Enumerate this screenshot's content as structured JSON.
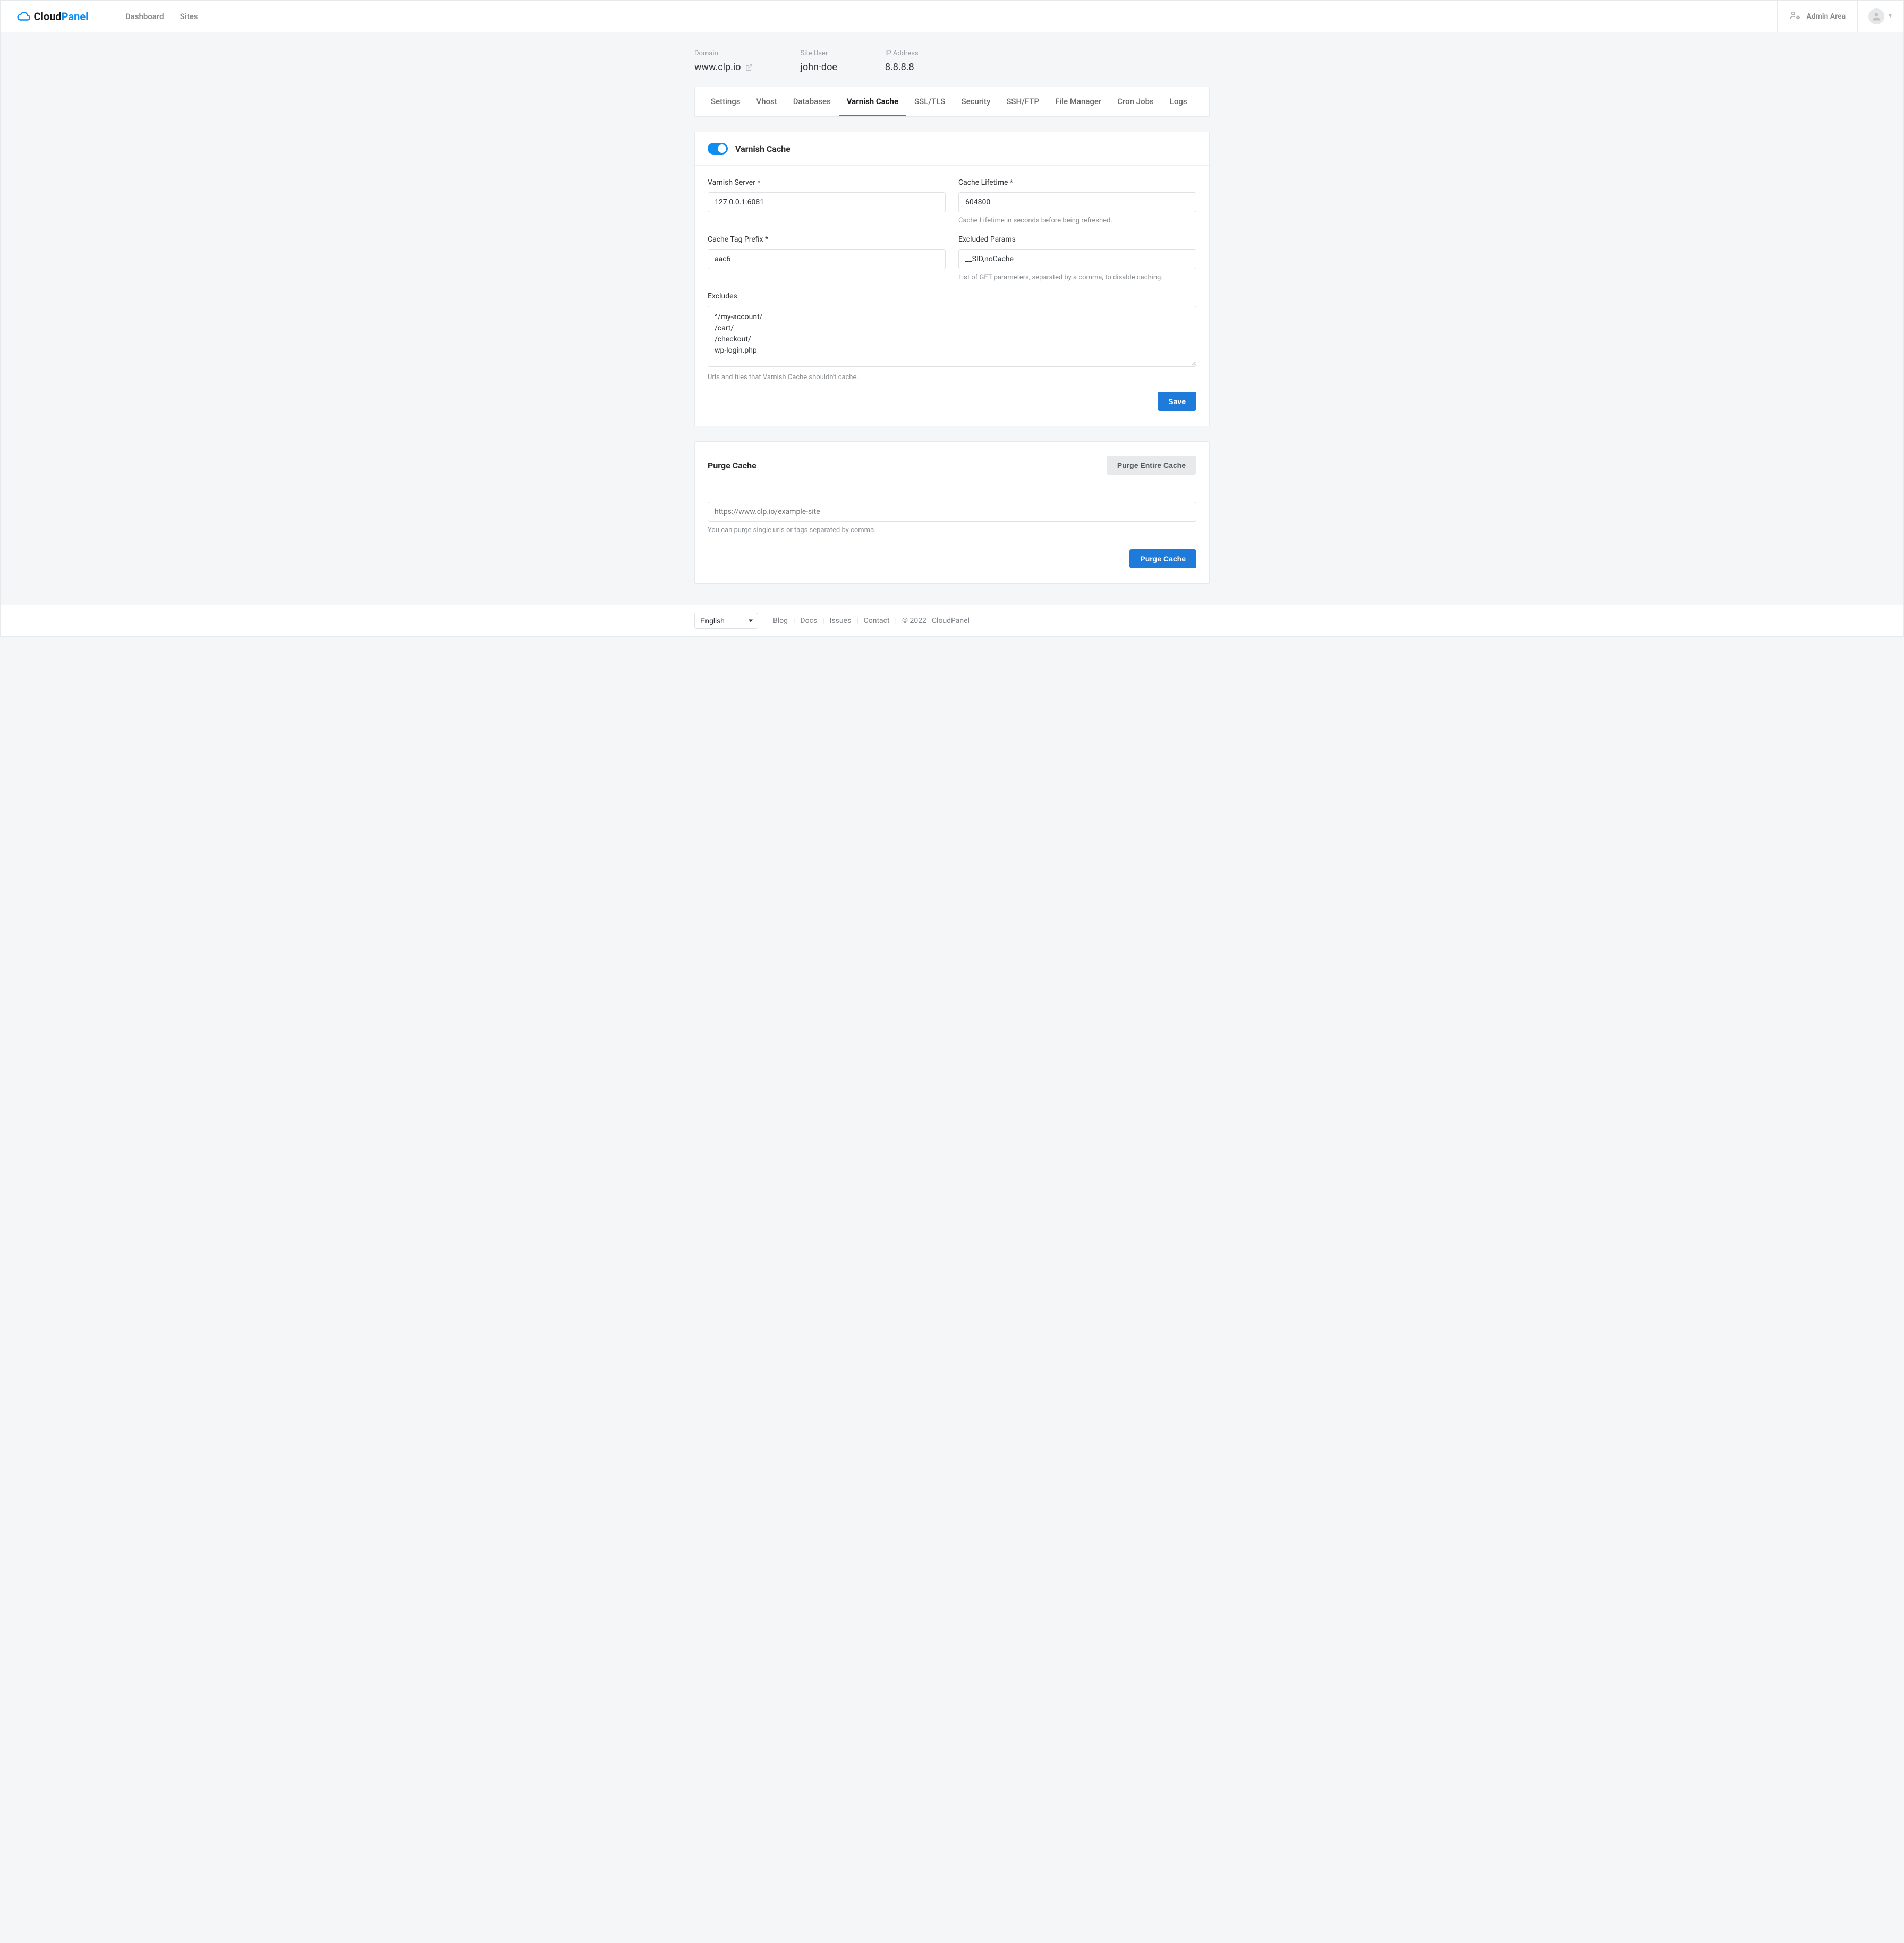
{
  "brand": {
    "name1": "Cloud",
    "name2": "Panel"
  },
  "nav": {
    "dashboard": "Dashboard",
    "sites": "Sites"
  },
  "adminArea": "Admin Area",
  "siteInfo": {
    "domainLabel": "Domain",
    "domainValue": "www.clp.io",
    "userLabel": "Site User",
    "userValue": "john-doe",
    "ipLabel": "IP Address",
    "ipValue": "8.8.8.8"
  },
  "tabs": {
    "settings": "Settings",
    "vhost": "Vhost",
    "databases": "Databases",
    "varnish": "Varnish Cache",
    "ssltls": "SSL/TLS",
    "security": "Security",
    "sshftp": "SSH/FTP",
    "filemanager": "File Manager",
    "cron": "Cron Jobs",
    "logs": "Logs"
  },
  "varnish": {
    "title": "Varnish Cache",
    "serverLabel": "Varnish Server *",
    "serverValue": "127.0.0.1:6081",
    "lifetimeLabel": "Cache Lifetime *",
    "lifetimeValue": "604800",
    "lifetimeHelp": "Cache Lifetime in seconds before being refreshed.",
    "tagPrefixLabel": "Cache Tag Prefix *",
    "tagPrefixValue": "aac6",
    "excludedParamsLabel": "Excluded Params",
    "excludedParamsValue": "__SID,noCache",
    "excludedParamsHelp": "List of GET parameters, separated by a comma, to disable caching.",
    "excludesLabel": "Excludes",
    "excludesValue": "^/my-account/\n/cart/\n/checkout/\nwp-login.php",
    "excludesHelp": "Urls and files that Varnish Cache shouldn't cache.",
    "saveBtn": "Save"
  },
  "purge": {
    "title": "Purge Cache",
    "purgeAllBtn": "Purge Entire Cache",
    "urlPlaceholder": "https://www.clp.io/example-site",
    "urlHelp": "You can purge single urls or tags separated by comma.",
    "purgeBtn": "Purge Cache"
  },
  "footer": {
    "language": "English",
    "blog": "Blog",
    "docs": "Docs",
    "issues": "Issues",
    "contact": "Contact",
    "copyright": "© 2022",
    "brand": "CloudPanel"
  }
}
